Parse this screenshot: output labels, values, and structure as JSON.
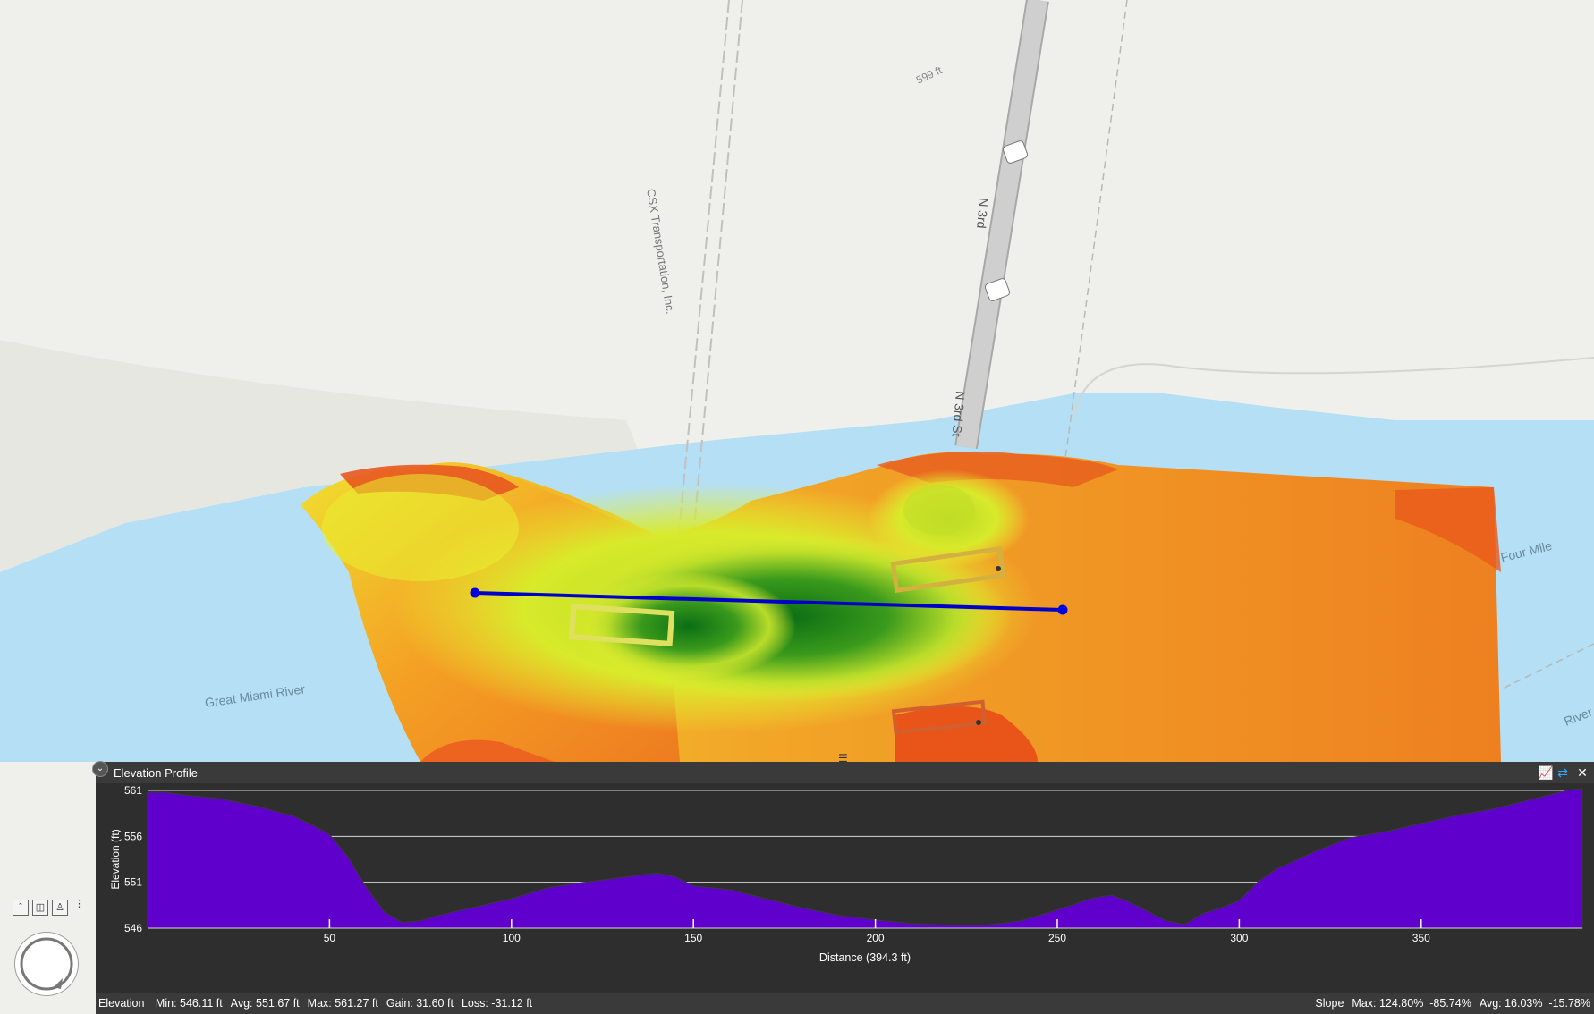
{
  "map": {
    "labels": {
      "csx": "CSX Transportation, Inc.",
      "n3rd_a": "N 3rd",
      "n3rd_b": "N 3rd St",
      "great_miami": "Great Miami River",
      "four_mile_a": "Four Mile",
      "four_mile_b": "River",
      "marker": "599 ft"
    },
    "colors": {
      "land": "#efefeb",
      "water": "#b4dff5",
      "road": "#c8c8c8",
      "profile_line": "#0000c8",
      "elev_low": "#0a7a1a",
      "elev_mid": "#e8f030",
      "elev_high": "#e84818"
    }
  },
  "panel": {
    "title": "Elevation Profile",
    "icons": {
      "collapse": "chevron-down-icon",
      "chart_type": "chart-icon",
      "swap": "swap-direction-icon",
      "close": "close-icon"
    }
  },
  "chart_data": {
    "type": "area",
    "title": "",
    "xlabel": "Distance (394.3 ft)",
    "ylabel": "Elevation (ft)",
    "xlim": [
      0,
      394.3
    ],
    "ylim": [
      546,
      561
    ],
    "xticks": [
      50,
      100,
      150,
      200,
      250,
      300,
      350
    ],
    "yticks": [
      546,
      551,
      556,
      561
    ],
    "grid": true,
    "series": [
      {
        "color": "#6000cc",
        "x": [
          0,
          5,
          10,
          20,
          30,
          40,
          45,
          50,
          55,
          60,
          65,
          70,
          75,
          80,
          90,
          100,
          110,
          120,
          130,
          140,
          145,
          150,
          160,
          170,
          180,
          190,
          200,
          210,
          220,
          230,
          240,
          250,
          260,
          265,
          270,
          275,
          280,
          285,
          290,
          295,
          300,
          305,
          310,
          320,
          330,
          340,
          350,
          360,
          370,
          380,
          390,
          394.3
        ],
        "y": [
          560.8,
          560.8,
          560.5,
          560.1,
          559.3,
          558.2,
          557.3,
          556.2,
          553.8,
          550.5,
          547.8,
          546.6,
          546.8,
          547.4,
          548.3,
          549.2,
          550.4,
          551.0,
          551.5,
          552.0,
          551.6,
          550.6,
          550.2,
          549.2,
          548.2,
          547.4,
          546.9,
          546.5,
          546.3,
          546.3,
          546.8,
          548.0,
          549.3,
          549.6,
          548.8,
          547.8,
          546.8,
          546.4,
          547.6,
          548.2,
          549.0,
          551.0,
          552.4,
          554.2,
          555.8,
          556.5,
          557.4,
          558.3,
          559.0,
          560.0,
          561.0,
          561.2
        ]
      }
    ]
  },
  "status": {
    "elevation_label": "Elevation",
    "elev_min": "Min: 546.11 ft",
    "elev_avg": "Avg: 551.67 ft",
    "elev_max": "Max: 561.27 ft",
    "elev_gain": "Gain: 31.60 ft",
    "elev_loss": "Loss: -31.12 ft",
    "slope_label": "Slope",
    "slope_max": "Max: 124.80%  -85.74%",
    "slope_avg": "Avg: 16.03%  -15.78%"
  }
}
